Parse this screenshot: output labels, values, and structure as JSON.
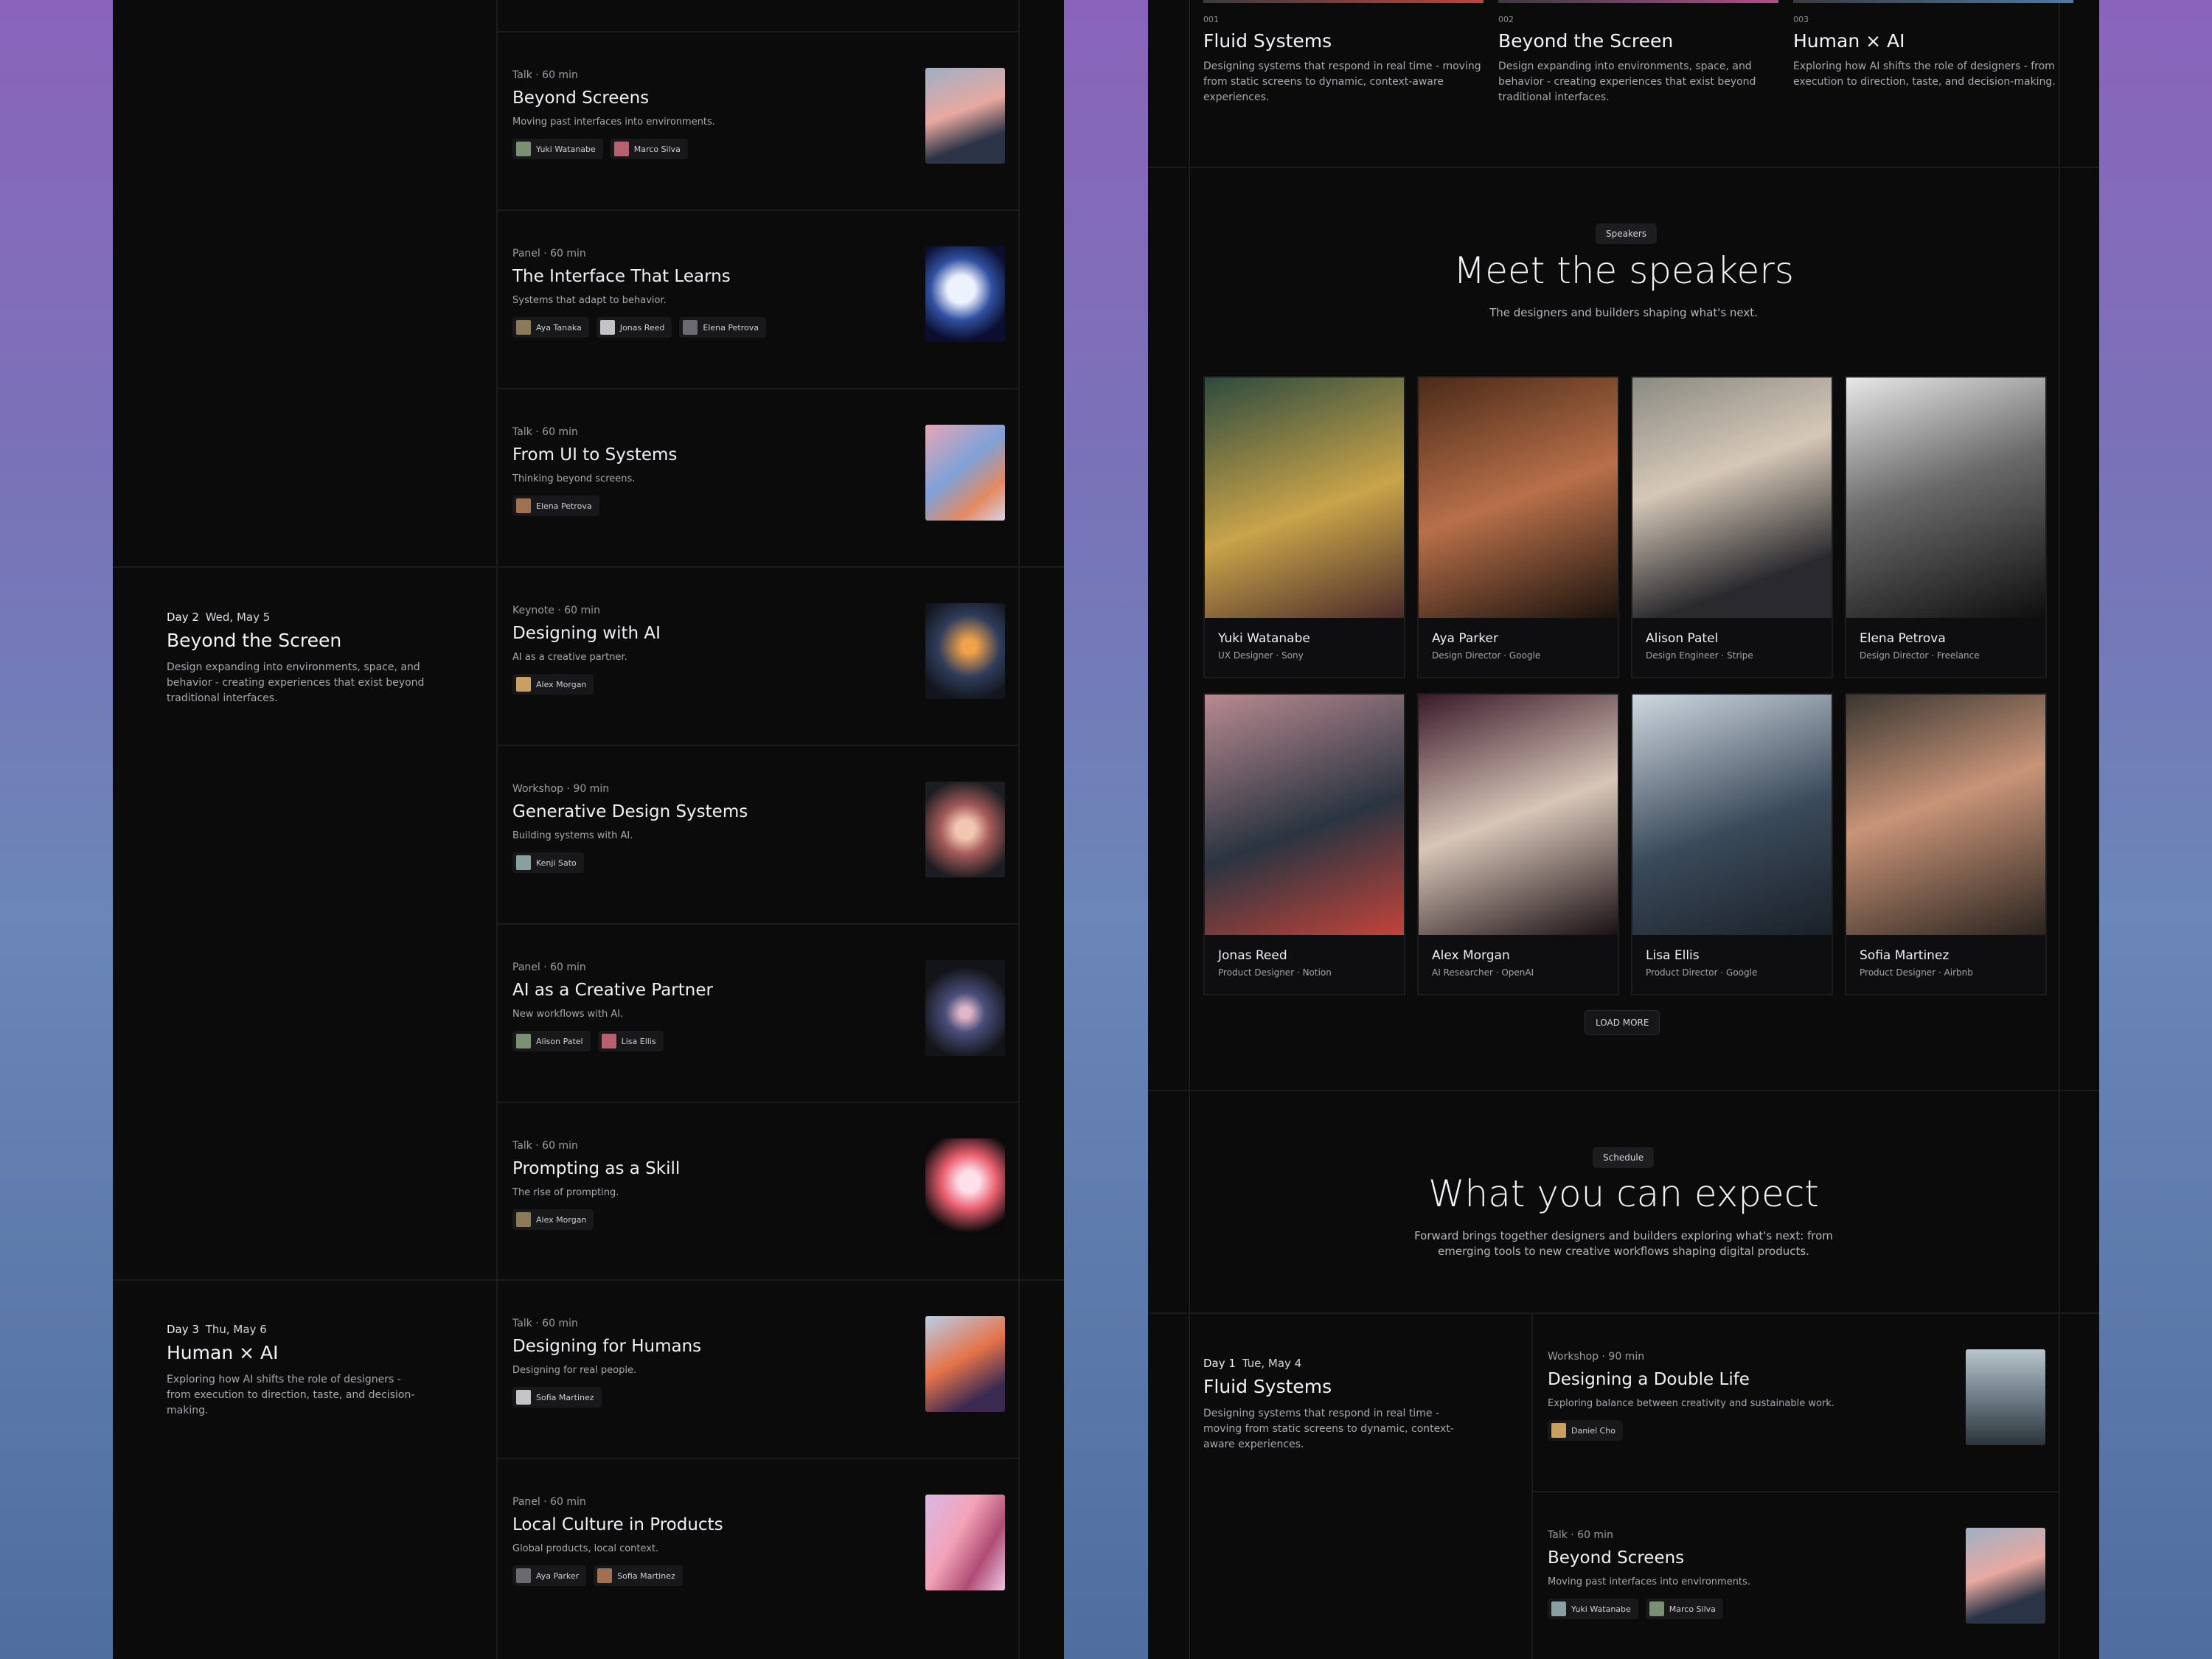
{
  "left": {
    "sessions_day1": [
      {
        "meta": "Talk · 60 min",
        "title": "Beyond Screens",
        "desc": "Moving past interfaces into environments.",
        "speakers": [
          "Yuki Watanabe",
          "Marco Silva"
        ]
      },
      {
        "meta": "Panel · 60 min",
        "title": "The Interface That Learns",
        "desc": "Systems that adapt to behavior.",
        "speakers": [
          "Aya Tanaka",
          "Jonas Reed",
          "Elena Petrova"
        ]
      },
      {
        "meta": "Talk · 60 min",
        "title": "From UI to Systems",
        "desc": "Thinking beyond screens.",
        "speakers": [
          "Elena Petrova"
        ]
      }
    ],
    "day2": {
      "day": "Day 2",
      "date": "Wed, May 5",
      "title": "Beyond the Screen",
      "desc": "Design expanding into environments, space, and behavior - creating experiences that exist beyond traditional interfaces."
    },
    "sessions_day2": [
      {
        "meta": "Keynote · 60 min",
        "title": "Designing with AI",
        "desc": "AI as a creative partner.",
        "speakers": [
          "Alex Morgan"
        ]
      },
      {
        "meta": "Workshop · 90 min",
        "title": "Generative Design Systems",
        "desc": "Building systems with AI.",
        "speakers": [
          "Kenji Sato"
        ]
      },
      {
        "meta": "Panel · 60 min",
        "title": "AI as a Creative Partner",
        "desc": "New workflows with AI.",
        "speakers": [
          "Alison Patel",
          "Lisa Ellis"
        ]
      },
      {
        "meta": "Talk · 60 min",
        "title": "Prompting as a Skill",
        "desc": "The rise of prompting.",
        "speakers": [
          "Alex Morgan"
        ]
      }
    ],
    "day3": {
      "day": "Day 3",
      "date": "Thu, May 6",
      "title": "Human × AI",
      "desc": "Exploring how AI shifts the role of designers - from execution to direction, taste, and decision-making."
    },
    "sessions_day3": [
      {
        "meta": "Talk · 60 min",
        "title": "Designing for Humans",
        "desc": "Designing for real people.",
        "speakers": [
          "Sofia Martinez"
        ]
      },
      {
        "meta": "Panel · 60 min",
        "title": "Local Culture in Products",
        "desc": "Global products, local context.",
        "speakers": [
          "Aya Parker",
          "Sofia Martinez"
        ]
      }
    ]
  },
  "right": {
    "features": [
      {
        "num": "001",
        "title": "Fluid Systems",
        "desc": "Designing systems that respond in real time - moving from static screens to dynamic, context-aware experiences."
      },
      {
        "num": "002",
        "title": "Beyond the Screen",
        "desc": "Design expanding into environments, space, and behavior - creating experiences that exist beyond traditional interfaces."
      },
      {
        "num": "003",
        "title": "Human × AI",
        "desc": "Exploring how AI shifts the role of designers - from execution to direction, taste, and decision-making."
      }
    ],
    "speakers_section": {
      "pill": "Speakers",
      "title": "Meet the speakers",
      "subtitle": "The designers and builders shaping what's next.",
      "load_more": "LOAD MORE"
    },
    "speakers": [
      {
        "name": "Yuki Watanabe",
        "role": "UX Designer · Sony"
      },
      {
        "name": "Aya Parker",
        "role": "Design Director · Google"
      },
      {
        "name": "Alison Patel",
        "role": "Design Engineer · Stripe"
      },
      {
        "name": "Elena Petrova",
        "role": "Design Director · Freelance"
      },
      {
        "name": "Jonas Reed",
        "role": "Product Designer · Notion"
      },
      {
        "name": "Alex Morgan",
        "role": "AI Researcher · OpenAI"
      },
      {
        "name": "Lisa Ellis",
        "role": "Product Director · Google"
      },
      {
        "name": "Sofia Martinez",
        "role": "Product Designer · Airbnb"
      }
    ],
    "schedule_section": {
      "pill": "Schedule",
      "title": "What you can expect",
      "subtitle": "Forward brings together designers and builders exploring what's next: from emerging tools to new creative workflows shaping digital products."
    },
    "day1": {
      "day": "Day 1",
      "date": "Tue, May 4",
      "title": "Fluid Systems",
      "desc": "Designing systems that respond in real time - moving from static screens to dynamic, context-aware experiences."
    },
    "sessions_day1": [
      {
        "meta": "Workshop · 90 min",
        "title": "Designing a Double Life",
        "desc": "Exploring balance between creativity and sustainable work.",
        "speakers": [
          "Daniel Cho"
        ]
      },
      {
        "meta": "Talk · 60 min",
        "title": "Beyond Screens",
        "desc": "Moving past interfaces into environments.",
        "speakers": [
          "Yuki Watanabe",
          "Marco Silva"
        ]
      }
    ]
  },
  "colors": {
    "panel_bg": "#0b0b0c",
    "accent_bar_1": "#c2433a",
    "accent_bar_2": "#b64c8c",
    "accent_bar_3": "#4c7aa8"
  }
}
